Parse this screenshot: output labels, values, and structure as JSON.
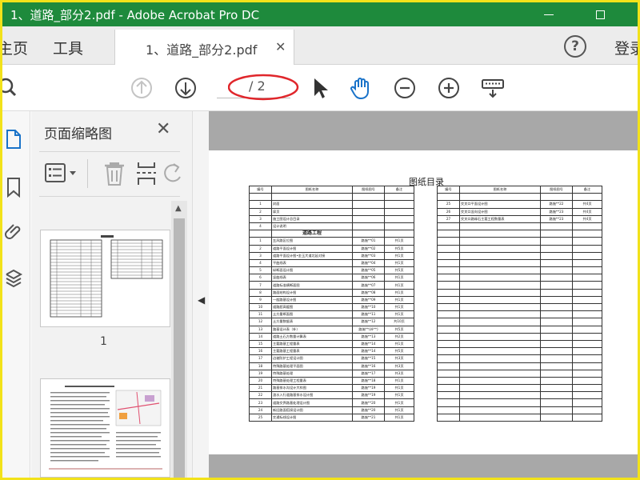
{
  "window": {
    "title": "1、道路_部分2.pdf - Adobe Acrobat Pro DC"
  },
  "menu": {
    "home": "主页",
    "tools": "工具",
    "signin": "登录"
  },
  "doc_tab": {
    "label": "1、道路_部分2.pdf"
  },
  "toolbar": {
    "page_total": "/ 2"
  },
  "thumb_panel": {
    "title": "页面缩略图",
    "thumbnails": [
      {
        "page": "1"
      }
    ]
  },
  "icons": {
    "search": "search-icon",
    "prev": "arrow-up-circle-icon",
    "next": "arrow-down-circle-icon",
    "select": "cursor-arrow-icon",
    "hand": "hand-icon",
    "zoom_out": "zoom-out-icon",
    "zoom_in": "zoom-in-icon",
    "keyboard": "keyboard-icon"
  },
  "colors": {
    "titlebar": "#1e8a3c",
    "border": "#f2e21a",
    "accent": "#1a73c9",
    "annotation": "#e0262b"
  },
  "document": {
    "title": "图纸目录",
    "headers": [
      "编号",
      "图纸名称",
      "图纸图号",
      "备注"
    ],
    "left_rows": [
      [
        "",
        "",
        "",
        ""
      ],
      [
        "1",
        "封面",
        "",
        ""
      ],
      [
        "2",
        "扉页",
        "",
        ""
      ],
      [
        "3",
        "施工图设计总目录",
        "",
        ""
      ],
      [
        "4",
        "设计说明",
        "",
        ""
      ],
      [
        "section",
        "道路工程"
      ],
      [
        "1",
        "五风路区位图",
        "路施**01",
        "共1页"
      ],
      [
        "2",
        "道路平面设计图",
        "路施**02",
        "共5页"
      ],
      [
        "3",
        "道路平面设计图•金玉大道北延对接",
        "路施**03",
        "共1页"
      ],
      [
        "4",
        "平曲线表",
        "路施**04",
        "共1页"
      ],
      [
        "5",
        "纵断面设计图",
        "路施**05",
        "共5页"
      ],
      [
        "6",
        "竖曲线表",
        "路施**06",
        "共1页"
      ],
      [
        "7",
        "道路标准横断面图",
        "路施**07",
        "共1页"
      ],
      [
        "8",
        "路面结构设计图",
        "路施**08",
        "共1页"
      ],
      [
        "9",
        "一般路基设计图",
        "路施**09",
        "共1页"
      ],
      [
        "10",
        "道路超高缓图",
        "路施**10",
        "共1页"
      ],
      [
        "11",
        "土方量断面图",
        "路施**11",
        "共1页"
      ],
      [
        "12",
        "土方量数据表",
        "路施**12",
        "共10页"
      ],
      [
        "13",
        "路基设计表（补）",
        "路施**(补**)",
        "共5页"
      ],
      [
        "14",
        "道路土石方数量计算表",
        "路施**13",
        "共2页"
      ],
      [
        "15",
        "主要路基工程量表",
        "路施**14",
        "共1页"
      ],
      [
        "16",
        "主要路基工程量表",
        "路施**14",
        "共5页"
      ],
      [
        "17",
        "边坡防护工程设计图",
        "路施**15",
        "共3页"
      ],
      [
        "18",
        "特殊路基处理平面图",
        "路施**16",
        "共3页"
      ],
      [
        "19",
        "特殊路基处理",
        "路施**17",
        "共3页"
      ],
      [
        "20",
        "特殊路基处理工程量表",
        "路施**18",
        "共1页"
      ],
      [
        "21",
        "路基排水沟设计大样图",
        "路施**19",
        "共1页"
      ],
      [
        "22",
        "渣水入行道路基排水设计图",
        "路施**19",
        "共1页"
      ],
      [
        "23",
        "道路交界路基处理设计图",
        "路施**20",
        "共1页"
      ],
      [
        "24",
        "新旧路面搭接设计图",
        "路施**20",
        "共1页"
      ],
      [
        "25",
        "交通标线设计图",
        "路施**21",
        "共1页"
      ]
    ],
    "right_rows": [
      [
        "",
        "",
        "",
        ""
      ],
      [
        "25",
        "交叉口平面设计图",
        "路施**22",
        "共4页"
      ],
      [
        "26",
        "交叉口竖向设计图",
        "路施**23",
        "共4页"
      ],
      [
        "27",
        "交叉口路缘石主要工程数量表",
        "路施**23",
        "共4页"
      ]
    ]
  }
}
